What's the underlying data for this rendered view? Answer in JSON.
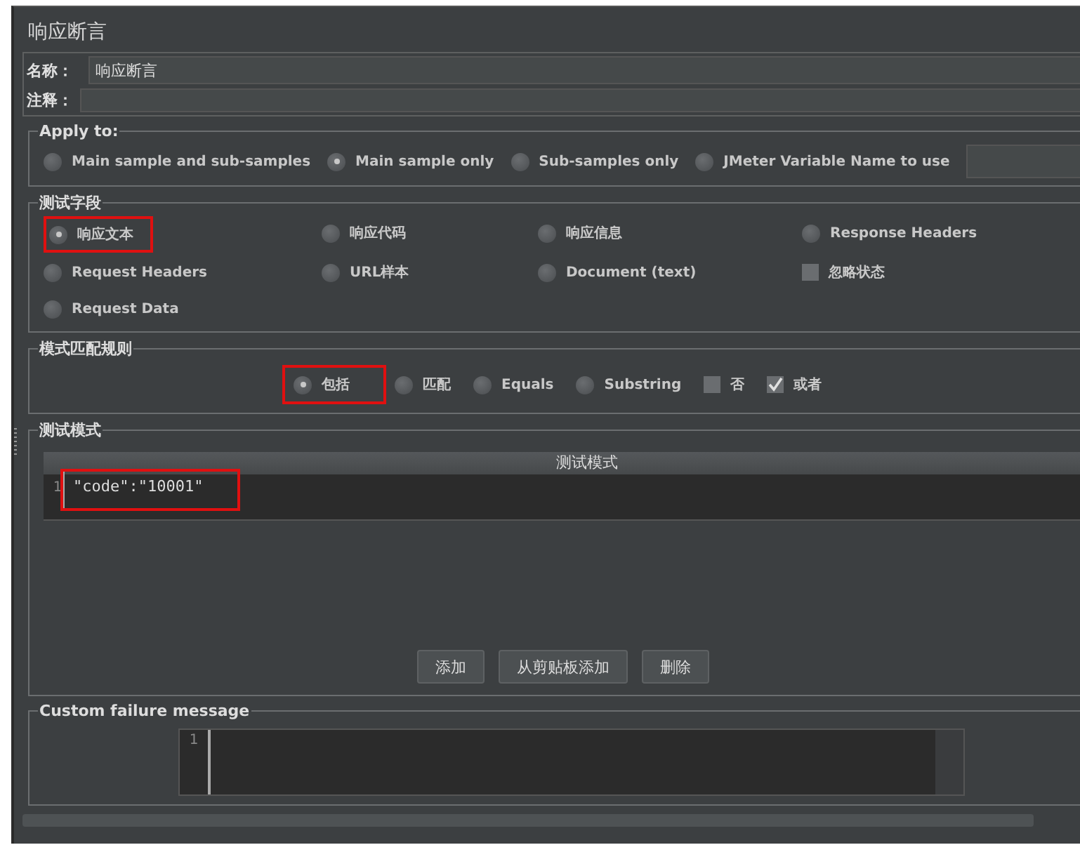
{
  "title": "响应断言",
  "name_field": {
    "label": "名称：",
    "value": "响应断言"
  },
  "comment_field": {
    "label": "注释："
  },
  "apply_to": {
    "legend": "Apply to:",
    "options": [
      {
        "label": "Main sample and sub-samples",
        "selected": false
      },
      {
        "label": "Main sample only",
        "selected": true
      },
      {
        "label": "Sub-samples only",
        "selected": false
      },
      {
        "label": "JMeter Variable Name to use",
        "selected": false
      }
    ]
  },
  "test_field": {
    "legend": "测试字段",
    "items": [
      {
        "kind": "radio",
        "label": "响应文本",
        "selected": true,
        "highlighted": true
      },
      {
        "kind": "radio",
        "label": "响应代码",
        "selected": false,
        "highlighted": false
      },
      {
        "kind": "radio",
        "label": "响应信息",
        "selected": false,
        "highlighted": false
      },
      {
        "kind": "radio",
        "label": "Response Headers",
        "selected": false,
        "highlighted": false
      },
      {
        "kind": "radio",
        "label": "Request Headers",
        "selected": false,
        "highlighted": false
      },
      {
        "kind": "radio",
        "label": "URL样本",
        "selected": false,
        "highlighted": false
      },
      {
        "kind": "radio",
        "label": "Document (text)",
        "selected": false,
        "highlighted": false
      },
      {
        "kind": "checkbox",
        "label": "忽略状态",
        "checked": false,
        "highlighted": false
      },
      {
        "kind": "radio",
        "label": "Request Data",
        "selected": false,
        "highlighted": false
      }
    ]
  },
  "match_rule": {
    "legend": "模式匹配规则",
    "items": [
      {
        "kind": "radio",
        "label": "包括",
        "selected": true,
        "highlighted": true
      },
      {
        "kind": "radio",
        "label": "匹配",
        "selected": false,
        "highlighted": false
      },
      {
        "kind": "radio",
        "label": "Equals",
        "selected": false,
        "highlighted": false
      },
      {
        "kind": "radio",
        "label": "Substring",
        "selected": false,
        "highlighted": false
      },
      {
        "kind": "checkbox",
        "label": "否",
        "checked": false,
        "highlighted": false
      },
      {
        "kind": "checkbox",
        "label": "或者",
        "checked": true,
        "highlighted": false
      }
    ]
  },
  "patterns": {
    "legend": "测试模式",
    "header": "测试模式",
    "rows": [
      {
        "line": "1",
        "text": "\"code\":\"10001\"",
        "highlighted": true
      }
    ],
    "buttons": [
      "添加",
      "从剪贴板添加",
      "删除"
    ]
  },
  "failure_message": {
    "legend": "Custom failure message",
    "lines": [
      "1"
    ]
  }
}
